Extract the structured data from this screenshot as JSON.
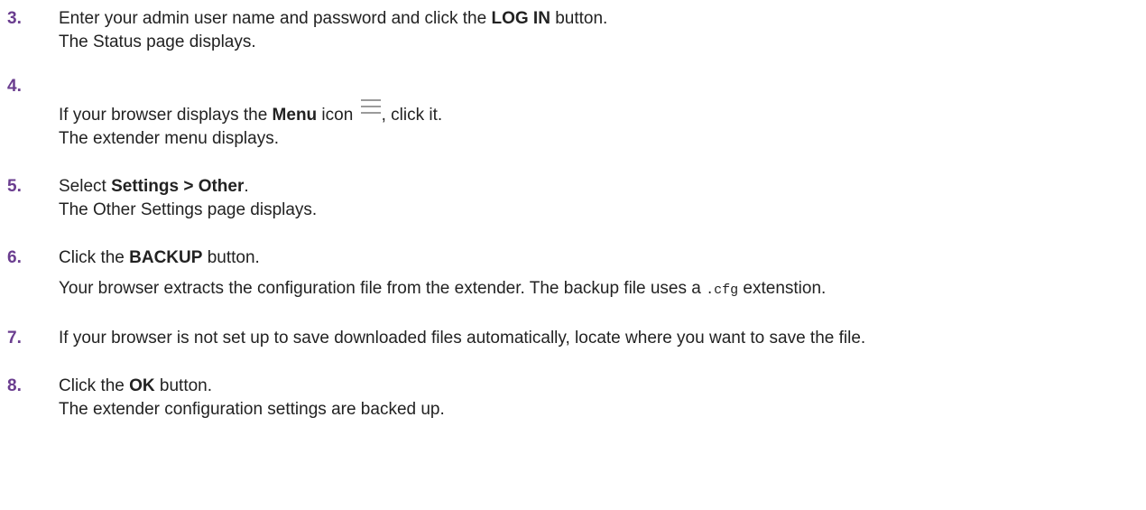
{
  "steps": [
    {
      "number": "3.",
      "instruction": {
        "before": "Enter your admin user name and password and click the ",
        "bold": "LOG IN",
        "after": " button."
      },
      "result": "The Status page displays."
    },
    {
      "number": "4.",
      "instruction": {
        "before": "If your browser displays the ",
        "bold": "Menu",
        "middle": " icon",
        "icon": "menu-hamburger-icon",
        "after": ", click it."
      },
      "result": "The extender menu displays."
    },
    {
      "number": "5.",
      "instruction": {
        "before": "Select ",
        "bold": "Settings > Other",
        "after": "."
      },
      "result": "The Other Settings page displays."
    },
    {
      "number": "6.",
      "instruction": {
        "before": "Click the ",
        "bold": "BACKUP",
        "after": " button."
      },
      "result": {
        "before": "Your browser extracts the configuration file from the extender. The backup file uses a ",
        "code": ".cfg",
        "after": " extenstion."
      }
    },
    {
      "number": "7.",
      "instruction": "If your browser is not set up to save downloaded files automatically, locate where you want to save the file."
    },
    {
      "number": "8.",
      "instruction": {
        "before": "Click the ",
        "bold": "OK",
        "after": " button."
      },
      "result": "The extender configuration settings are backed up."
    }
  ],
  "colors": {
    "step_number": "#6a3d8f",
    "body_text": "#222222",
    "icon": "#9a9a9a"
  }
}
